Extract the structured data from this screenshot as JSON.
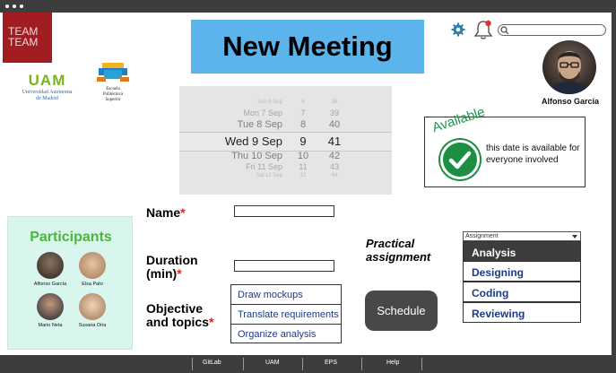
{
  "logos": {
    "team": "TEAM TEAM",
    "uam_mark": "UAM",
    "uam_name_line1": "Universidad Autónoma",
    "uam_name_line2": "de Madrid",
    "eps_line1": "Escuela",
    "eps_line2": "Politécnica",
    "eps_line3": "Superior"
  },
  "header": {
    "title": "New Meeting",
    "icons": [
      "gear-icon",
      "bell-icon",
      "search-icon"
    ],
    "user_name": "Alfonso García"
  },
  "date_picker": {
    "rows": [
      {
        "day": "Sun 6 Sep",
        "mid": "6",
        "num": "36"
      },
      {
        "day": "Mon 7 Sep",
        "mid": "7",
        "num": "39"
      },
      {
        "day": "Tue 8 Sep",
        "mid": "8",
        "num": "40"
      },
      {
        "day": "Wed 9 Sep",
        "mid": "9",
        "num": "41"
      },
      {
        "day": "Thu 10 Sep",
        "mid": "10",
        "num": "42"
      },
      {
        "day": "Fri 11 Sep",
        "mid": "11",
        "num": "43"
      },
      {
        "day": "Sat 12 Sep",
        "mid": "12",
        "num": "44"
      }
    ]
  },
  "availability": {
    "label": "Available",
    "message": "this date is available for everyone involved"
  },
  "participants": {
    "title": "Participants",
    "people": [
      {
        "name": "Alfonso García",
        "color": "#3b312b"
      },
      {
        "name": "Elsa Pato",
        "color": "#c9a27e"
      },
      {
        "name": "Mario Neta",
        "color": "#2f3440"
      },
      {
        "name": "Susana Oria",
        "color": "#b98f6c"
      }
    ]
  },
  "form": {
    "name_label": "Name",
    "duration_label_1": "Duration",
    "duration_label_2": "(min)",
    "objective_label_1": "Objective",
    "objective_label_2": "and topics",
    "required_mark": "*",
    "topics": [
      "Draw mockups",
      "Translate requirements",
      "Organize analysis"
    ],
    "practical_label_1": "Practical",
    "practical_label_2": "assignment",
    "assignment_placeholder": "Assignment",
    "assignment_options": [
      "Analysis",
      "Designing",
      "Coding",
      "Reviewing"
    ],
    "schedule_label": "Schedule"
  },
  "footer": {
    "links": [
      "GitLab",
      "UAM",
      "EPS",
      "Help"
    ]
  },
  "colors": {
    "title_bg": "#5bb4ec",
    "brand_red": "#a11d22",
    "available_green": "#1c8f43",
    "participants_bg": "#d8f6ee",
    "link_blue": "#1b3a8a",
    "chrome": "#3d3d3d"
  }
}
